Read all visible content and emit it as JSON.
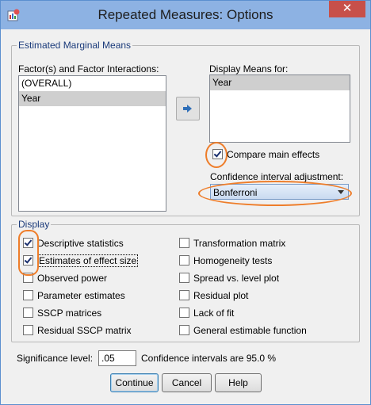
{
  "window": {
    "title": "Repeated Measures: Options",
    "close_symbol": "✕",
    "app_icon": "spss-icon"
  },
  "emm": {
    "group_label": "Estimated Marginal Means",
    "factors_label": "Factor(s) and Factor Interactions:",
    "factors": [
      {
        "label": "(OVERALL)",
        "selected": false
      },
      {
        "label": "Year",
        "selected": true
      }
    ],
    "move_button_icon": "arrow-right-icon",
    "display_means_label": "Display Means for:",
    "display_means": [
      {
        "label": "Year",
        "selected": true
      }
    ],
    "compare_main_effects": {
      "label": "Compare main effects",
      "checked": true
    },
    "ci_adjustment_label": "Confidence interval adjustment:",
    "ci_adjustment_value": "Bonferroni"
  },
  "display": {
    "group_label": "Display",
    "left": [
      {
        "label": "Descriptive statistics",
        "checked": true
      },
      {
        "label": "Estimates of effect size",
        "checked": true
      },
      {
        "label": "Observed power",
        "checked": false
      },
      {
        "label": "Parameter estimates",
        "checked": false
      },
      {
        "label": "SSCP matrices",
        "checked": false
      },
      {
        "label": "Residual SSCP matrix",
        "checked": false
      }
    ],
    "right": [
      {
        "label": "Transformation matrix",
        "checked": false
      },
      {
        "label": "Homogeneity tests",
        "checked": false
      },
      {
        "label": "Spread vs. level plot",
        "checked": false
      },
      {
        "label": "Residual plot",
        "checked": false
      },
      {
        "label": "Lack of fit",
        "checked": false
      },
      {
        "label": "General estimable function",
        "checked": false
      }
    ]
  },
  "significance": {
    "label": "Significance level:",
    "value": ".05",
    "ci_text": "Confidence intervals are 95.0 %"
  },
  "buttons": {
    "continue": "Continue",
    "cancel": "Cancel",
    "help": "Help"
  },
  "colors": {
    "highlight_oval": "#ee7d2a",
    "titlebar": "#8db2e3",
    "close_button": "#c7504a"
  }
}
